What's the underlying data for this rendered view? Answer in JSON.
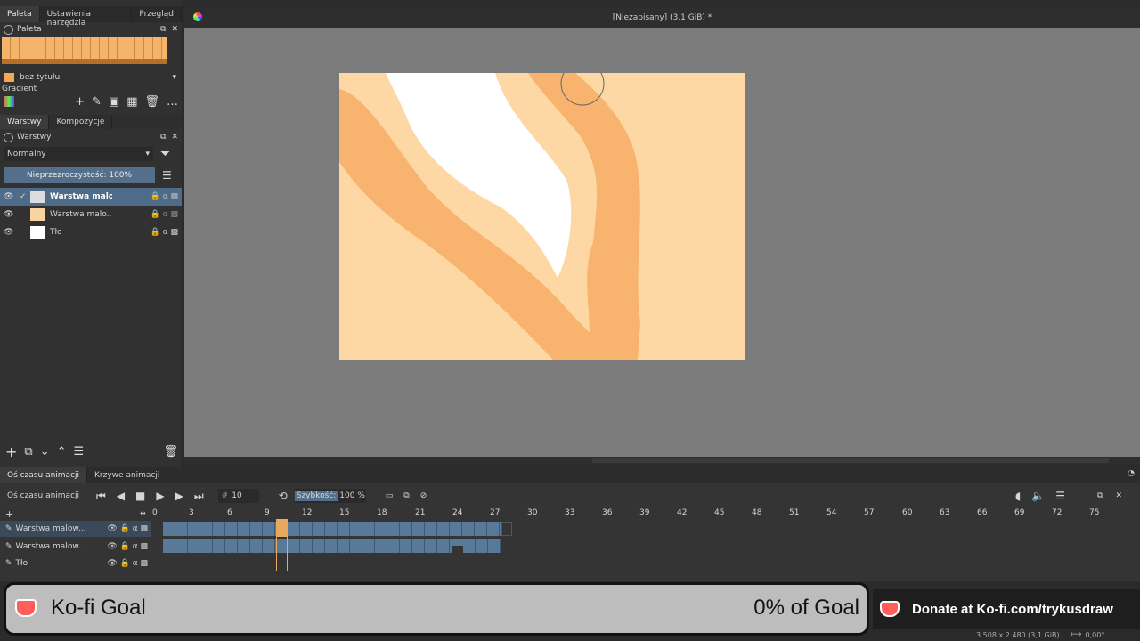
{
  "window": {
    "title": "[Niezapisany]  (3,1 GiB) *"
  },
  "left_tabs": [
    "Paleta",
    "Ustawienia narzędzia",
    "Przegląd"
  ],
  "palette": {
    "header": "Paleta",
    "name": "bez tytułu",
    "gradient_label": "Gradient"
  },
  "layers_tabs": [
    "Warstwy",
    "Kompozycje"
  ],
  "layers": {
    "header": "Warstwy",
    "blend_mode": "Normalny",
    "opacity_label": "Nieprzezroczystość:  100%",
    "items": [
      {
        "name": "Warstwa malo..."
      },
      {
        "name": "Warstwa malo..."
      },
      {
        "name": "Tło"
      }
    ]
  },
  "timeline": {
    "tabs": [
      "Oś czasu animacji",
      "Krzywe animacji"
    ],
    "title": "Oś czasu animacji",
    "frame_label": "#",
    "frame_value": "10",
    "speed_label": "Szybkość:",
    "speed_value": "100 %",
    "ruler": [
      "0",
      "3",
      "6",
      "9",
      "12",
      "15",
      "18",
      "21",
      "24",
      "27",
      "30",
      "33",
      "36",
      "39",
      "42",
      "45",
      "48",
      "51",
      "54",
      "57",
      "60",
      "63",
      "66",
      "69",
      "72",
      "75"
    ],
    "layers": [
      {
        "name": "Warstwa malow..."
      },
      {
        "name": "Warstwa malow..."
      },
      {
        "name": "Tło"
      }
    ]
  },
  "status": {
    "size": "3 508 x 2 480 (3,1 GiB)",
    "angle": "0,00°"
  },
  "kofi": {
    "goal_label": "Ko-fi Goal",
    "goal_percent": "0% of Goal",
    "donate": "Donate at Ko-fi.com/trykusdraw"
  },
  "colors": {
    "canvas_bg": "#7b7b7b",
    "light_peach": "#fdd8a4",
    "mid_peach": "#f8b46e",
    "selected_frame": "#e6a95e",
    "kofi_red": "#ff5e5b"
  }
}
